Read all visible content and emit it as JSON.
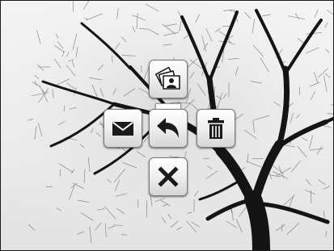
{
  "screen": {
    "background_photo": "bare-tree-photo",
    "photo_tone": "grayscale"
  },
  "action_menu": {
    "items": [
      {
        "id": "gallery",
        "icon": "photo-gallery-icon"
      },
      {
        "id": "email",
        "icon": "envelope-icon"
      },
      {
        "id": "back",
        "icon": "back-arrow-icon"
      },
      {
        "id": "delete",
        "icon": "trash-icon"
      },
      {
        "id": "close",
        "icon": "close-x-icon"
      }
    ],
    "colors": {
      "tile_top": "#ffffff",
      "tile_bottom": "#d6d6d6",
      "tile_border": "#7a7a7a",
      "icon": "#1a1a1a"
    }
  }
}
